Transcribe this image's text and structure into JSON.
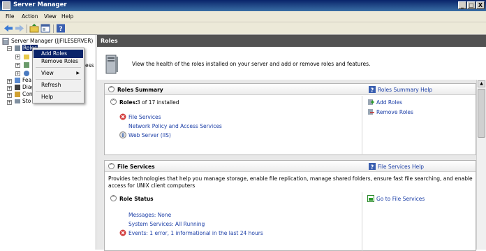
{
  "window": {
    "title": "Server Manager",
    "minimize": "_",
    "restore": "□",
    "close": "X"
  },
  "menu": {
    "file": "File",
    "action": "Action",
    "view": "View",
    "help": "Help"
  },
  "tree": {
    "root": "Server Manager (JJFILESERVER)",
    "roles": "Roles",
    "features": "Fea",
    "diagnostics": "Diag",
    "configuration": "Con",
    "storage": "Sto",
    "obscured_tail": "ess"
  },
  "context_menu": {
    "add_roles": "Add Roles",
    "remove_roles": "Remove Roles",
    "view": "View",
    "refresh": "Refresh",
    "help": "Help"
  },
  "main": {
    "header": "Roles",
    "intro": "View the health of the roles installed on your server and add or remove roles and features.",
    "roles_summary": {
      "title": "Roles Summary",
      "help": "Roles Summary Help",
      "roles_label": "Roles:",
      "roles_count": "3 of 17 installed",
      "items": [
        "File Services",
        "Network Policy and Access Services",
        "Web Server (IIS)"
      ],
      "add_roles": "Add Roles",
      "remove_roles": "Remove Roles"
    },
    "file_services": {
      "title": "File Services",
      "help": "File Services Help",
      "description": "Provides technologies that help you manage storage, enable file replication, manage shared folders, ensure fast file searching, and enable access for UNIX client computers",
      "role_status": "Role Status",
      "goto": "Go to File Services",
      "messages": "Messages: None",
      "system_services": "System Services: All Running",
      "events": "Events: 1 error, 1 informational in the last 24 hours"
    }
  }
}
